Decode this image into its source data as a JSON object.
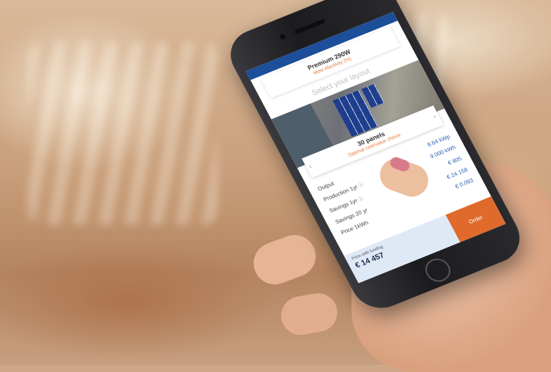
{
  "app": {
    "panel": {
      "title": "Premium 290W",
      "subtitle": "Most efectivity (%)"
    },
    "layout_heading": "Select your layout",
    "layout": {
      "count": "30 panels",
      "subtitle": "Optimal cost/value choice",
      "prev_icon": "‹",
      "next_icon": "›"
    },
    "stats": [
      {
        "label": "Output",
        "value": "8.64 kWp",
        "info": false
      },
      {
        "label": "Production 1yr",
        "value": "9 000 kWh",
        "info": true
      },
      {
        "label": "Savings 1yr",
        "value": "€ 805",
        "info": true
      },
      {
        "label": "Savings 20 yr",
        "value": "€ 24 158",
        "info": false
      },
      {
        "label": "Price 1kWh",
        "value": "€ 0.093",
        "info": false
      }
    ],
    "price": {
      "label": "Price with funding",
      "value": "€ 14 457"
    },
    "order_label": "Order",
    "info_icon": "ⓘ"
  },
  "colors": {
    "accent": "#e06a2b",
    "brand_blue": "#1c4e9a",
    "value_blue": "#2a5fb4"
  }
}
